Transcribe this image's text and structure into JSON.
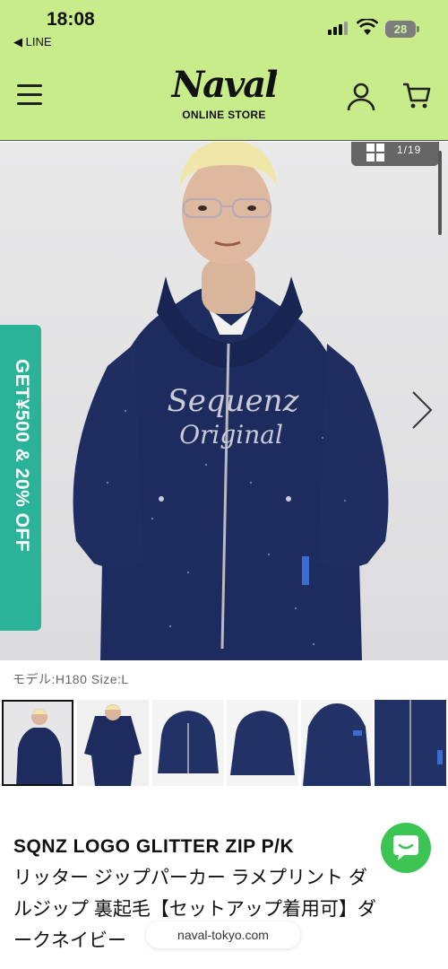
{
  "status_bar": {
    "time": "18:08",
    "back_app": "◀ LINE",
    "battery": "28"
  },
  "header": {
    "logo_text": "Naval",
    "logo_sub": "ONLINE STORE"
  },
  "gallery": {
    "counter": "1/19",
    "promo": "GET¥500 & 20% OFF",
    "caption": "モデル:H180 Size:L",
    "thumbnail_count": 6
  },
  "product": {
    "title_line1": "SQNZ LOGO GLITTER ZIP P/K ",
    "title_line2": "リッター ジップパーカー ラメプリント ダ",
    "title_line3": "ルジップ 裏起毛【セットアップ着用可】ダ",
    "title_line4": "ークネイビー"
  },
  "footer": {
    "url": "naval-tokyo.com"
  },
  "colors": {
    "header_bg": "#c9ec8a",
    "promo_bg": "#2bb39a",
    "chat_bg": "#3dc553",
    "hoodie": "#1d2b5e"
  }
}
